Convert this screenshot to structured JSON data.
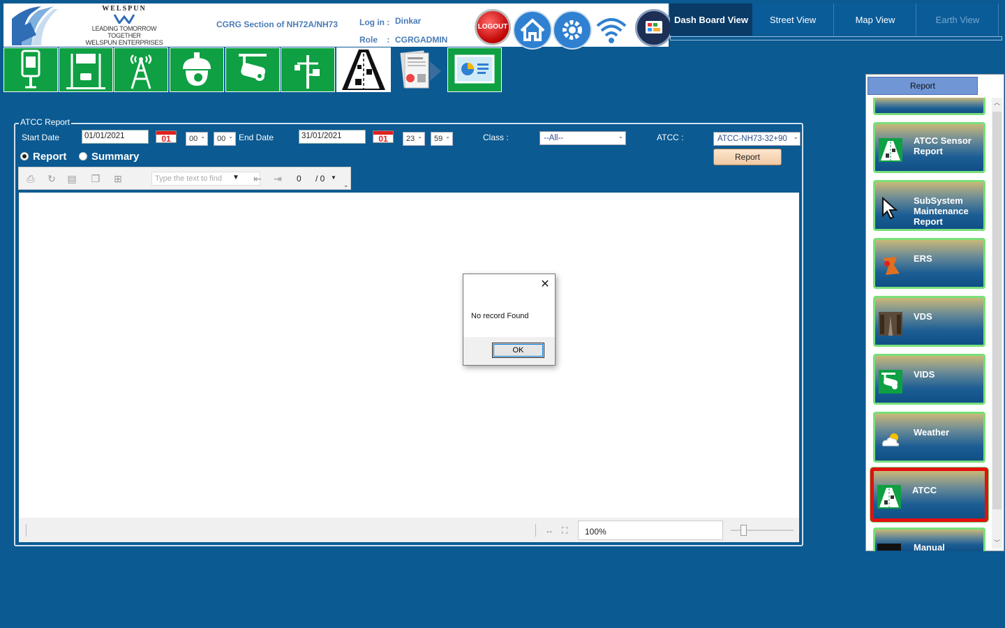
{
  "brand": {
    "name": "WELSPUN",
    "tagline": "LEADING TOMORROW TOGETHER",
    "company": "WELSPUN ENTERPRISES LTD."
  },
  "header": {
    "section": "CGRG Section of NH72A/NH73",
    "login_label": "Log in :",
    "login_value": "Dinkar",
    "role_label": "Role    :",
    "role_value": "CGRGADMIN",
    "logout_label": "LOGOUT"
  },
  "view_tabs": [
    "Dash Board View",
    "Street View",
    "Map View",
    "Earth View"
  ],
  "report": {
    "group_title": "ATCC Report",
    "start_date_label": "Start Date",
    "start_date": "01/01/2021",
    "start_cal_day": "01",
    "start_hour": "00",
    "start_min": "00",
    "end_date_label": "End Date",
    "end_date": "31/01/2021",
    "end_cal_day": "01",
    "end_hour": "23",
    "end_min": "59",
    "class_label": "Class :",
    "class_value": "--All--",
    "atcc_label": "ATCC :",
    "atcc_value": "ATCC-NH73-32+90",
    "radio_report": "Report",
    "radio_summary": "Summary",
    "report_button": "Report"
  },
  "viewer": {
    "find_placeholder": "Type the text to find",
    "page_current": "0",
    "page_total": "/ 0",
    "zoom": "100%"
  },
  "dialog": {
    "message": "No record Found",
    "ok": "OK"
  },
  "side": {
    "header": "Report",
    "items": [
      {
        "label": "ATCC Sensor Report"
      },
      {
        "label": "SubSystem Maintenance Report"
      },
      {
        "label": "ERS"
      },
      {
        "label": "VDS"
      },
      {
        "label": "VIDS"
      },
      {
        "label": "Weather"
      },
      {
        "label": "ATCC"
      },
      {
        "label": "Manual"
      }
    ]
  }
}
